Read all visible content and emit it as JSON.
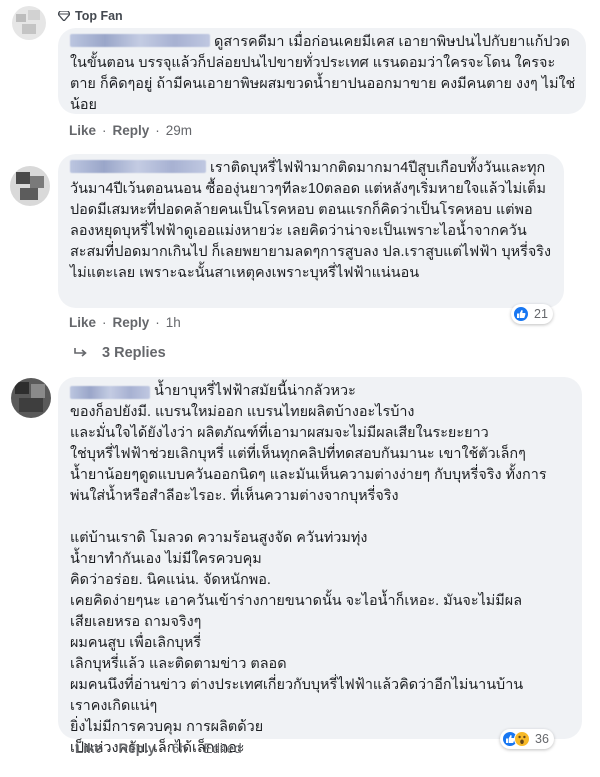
{
  "comments": [
    {
      "badge": "Top Fan",
      "text": "ดูสารคดีมา เมื่อก่อนเคยมีเคส เอายาพิษปนไปกับยาแก้ปวดในขั้นตอน บรรจุแล้วก็ปล่อยปนไปขายทั่วประเทศ แรนดอมว่าใครจะโดน ใครจะตาย ก็คิดๆอยู่ ถ้ามีคนเอายาพิษผสมขวดน้ำยาปนออกมาขาย คงมีคนตาย งงๆ ไม่ใช่น้อย",
      "like": "Like",
      "reply": "Reply",
      "time": "29m"
    },
    {
      "text": "เราติดบุหรี่ไฟฟ้ามากติดมากมา4ปีสูบเกือบทั้งวันและทุกวันมา4ปีเว้นตอนนอน ซื้อองุ่นยาวๆทีละ10ตลอด แต่หลังๆเริ่มหายใจแล้วไม่เต็มปอดมีเสมหะที่ปอดคล้ายคนเป็นโรคหอบ ตอนแรกก็คิดว่าเป็นโรคหอบ แต่พอลองหยุดบุหรี่ไฟฟ้าดูเออแม่งหายว่ะ เลยคิดว่าน่าจะเป็นเพราะไอน้ำจากควันสะสมที่ปอดมากเกินไป ก็เลยพยายามลดๆการสูบลง ปล.เราสูบแต่ไฟฟ้า บุหรี่จริงไม่แตะเลย เพราะฉะนั้นสาเหตุคงเพราะบุหรี่ไฟฟ้าแน่นอน",
      "like": "Like",
      "reply": "Reply",
      "time": "1h",
      "reaction_count": "21",
      "replies_label": "3 Replies"
    },
    {
      "text": "น้ำยาบุหรี่ไฟฟ้าสมัยนี้น่ากลัวหวะ\nของก็อปยังมี. แบรนใหม่ออก แบรนไทยผลิตบ้างอะไรบ้าง\nและมั่นใจได้ยังไงว่า ผลิตภัณฑ์ที่เอามาผสมจะไม่มีผลเสียในระยะยาว\nใช่บุหรี่ไฟฟ้าช่วยเลิกบุหรี่ แต่ที่เห็นทุกคลิปที่ทดสอบกันมานะ เขาใช้ตัวเล็กๆ\nน้ำยาน้อยๆดูดแบบควันออกนิดๆ และมันเห็นความต่างง่ายๆ กับบุหรี่จริง ทั้งการ\nพ่นใส่น้ำหรือสำลีอะไรอะ. ที่เห็นความต่างจากบุหรี่จริง\n\nแต่บ้านเราดิ โมลวด ความร้อนสูงจัด ควันท่วมทุ่ง\nน้ำยาทำกันเอง ไม่มีใครควบคุม\nคิดว่าอร่อย. นิคแน่น. จัดหนักพอ.\nเคยคิดง่ายๆนะ เอาควันเข้าร่างกายขนาดนั้น จะไอน้ำก็เหอะ. มันจะไม่มีผล\nเสียเลยหรอ ถามจริงๆ\nผมคนสูบ เพื่อเลิกบุหรี่\nเลิกบุหรี่แล้ว และติดตามข่าว ตลอด\nผมคนนึงที่อ่านข่าว ต่างประเทศเกี่ยวกับบุหรี่ไฟฟ้าแล้วคิดว่าอีกไม่นานบ้าน\nเราคงเกิดแน่ๆ\nยิ่งไม่มีการควบคุม การผลิตด้วย\nเป็นห่วงครับ. เล็กได้เล็กเถอะ",
      "like": "Like",
      "reply": "Reply",
      "time": "6h",
      "edited": "Edited",
      "reaction_count": "36"
    }
  ],
  "colors": {
    "bubble": "#f0f2f5",
    "meta": "#65676b",
    "like_blue": "#1877f2",
    "wow_yellow": "#f7b928"
  },
  "icons": [
    "diamond-icon",
    "like-reaction-icon",
    "wow-reaction-icon",
    "reply-arrow-icon"
  ]
}
